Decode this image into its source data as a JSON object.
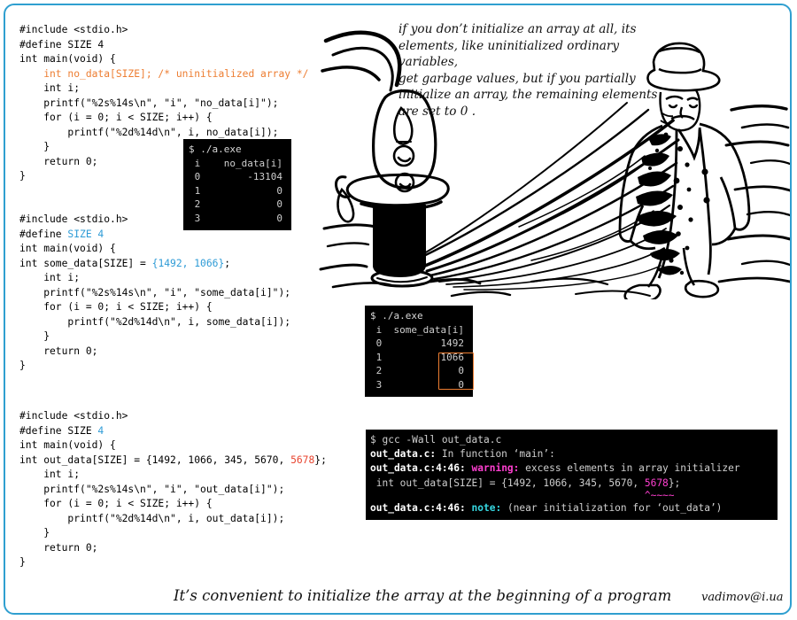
{
  "slide": {
    "border_color": "#2f9fd0",
    "background": "#ffffff"
  },
  "note": {
    "text": "if you don’t initialize an array at all, its\nelements, like uninitialized ordinary variables,\nget garbage values, but if you partially\ninitialize an array, the remaining elements\n        are set to 0 ."
  },
  "illustration": {
    "alt": "ink cartoon: drinking fountain spraying a man in a hat and overcoat"
  },
  "code_blocks": [
    {
      "id": "no_data",
      "lines": [
        [
          {
            "t": "#include <stdio.h>",
            "c": "black"
          }
        ],
        [
          {
            "t": "#define SIZE 4",
            "c": "black"
          }
        ],
        [
          {
            "t": "int main(void) {",
            "c": "black"
          }
        ],
        [
          {
            "t": "    int no_data[SIZE]; /* uninitialized array */",
            "c": "orange"
          }
        ],
        [
          {
            "t": "    int i;",
            "c": "black"
          }
        ],
        [
          {
            "t": "    printf(\"%2s%14s\\n\", \"i\", \"no_data[i]\");",
            "c": "black"
          }
        ],
        [
          {
            "t": "    for (i = 0; i < SIZE; i++) {",
            "c": "black"
          }
        ],
        [
          {
            "t": "        printf(\"%2d%14d\\n\", i, no_data[i]);",
            "c": "black"
          }
        ],
        [
          {
            "t": "    }",
            "c": "black"
          }
        ],
        [
          {
            "t": "    return 0;",
            "c": "black"
          }
        ],
        [
          {
            "t": "}",
            "c": "black"
          }
        ]
      ]
    },
    {
      "id": "some_data",
      "lines": [
        [
          {
            "t": "#include <stdio.h>",
            "c": "black"
          }
        ],
        [
          {
            "t": "#define ",
            "c": "black"
          },
          {
            "t": "SIZE 4",
            "c": "blue"
          }
        ],
        [
          {
            "t": "int main(void) {",
            "c": "black"
          }
        ],
        [
          {
            "t": "int some_data[SIZE] = ",
            "c": "black"
          },
          {
            "t": "{1492, 1066}",
            "c": "blue"
          },
          {
            "t": ";",
            "c": "black"
          }
        ],
        [
          {
            "t": "    int i;",
            "c": "black"
          }
        ],
        [
          {
            "t": "    printf(\"%2s%14s\\n\", \"i\", \"some_data[i]\");",
            "c": "black"
          }
        ],
        [
          {
            "t": "    for (i = 0; i < SIZE; i++) {",
            "c": "black"
          }
        ],
        [
          {
            "t": "        printf(\"%2d%14d\\n\", i, some_data[i]);",
            "c": "black"
          }
        ],
        [
          {
            "t": "    }",
            "c": "black"
          }
        ],
        [
          {
            "t": "    return 0;",
            "c": "black"
          }
        ],
        [
          {
            "t": "}",
            "c": "black"
          }
        ]
      ]
    },
    {
      "id": "out_data",
      "lines": [
        [
          {
            "t": "#include <stdio.h>",
            "c": "black"
          }
        ],
        [
          {
            "t": "#define SIZE ",
            "c": "black"
          },
          {
            "t": "4",
            "c": "blue"
          }
        ],
        [
          {
            "t": "int main(void) {",
            "c": "black"
          }
        ],
        [
          {
            "t": "int out_data[SIZE] = {1492, 1066, 345, 5670, ",
            "c": "black"
          },
          {
            "t": "5678",
            "c": "red"
          },
          {
            "t": "};",
            "c": "black"
          }
        ],
        [
          {
            "t": "    int i;",
            "c": "black"
          }
        ],
        [
          {
            "t": "    printf(\"%2s%14s\\n\", \"i\", \"out_data[i]\");",
            "c": "black"
          }
        ],
        [
          {
            "t": "    for (i = 0; i < SIZE; i++) {",
            "c": "black"
          }
        ],
        [
          {
            "t": "        printf(\"%2d%14d\\n\", i, out_data[i]);",
            "c": "black"
          }
        ],
        [
          {
            "t": "    }",
            "c": "black"
          }
        ],
        [
          {
            "t": "    return 0;",
            "c": "black"
          }
        ],
        [
          {
            "t": "}",
            "c": "black"
          }
        ]
      ]
    }
  ],
  "terminals": {
    "no_data_run": {
      "command": "$ ./a.exe",
      "header": " i    no_data[i]",
      "rows": [
        " 0        -13104",
        " 1             0",
        " 2             0",
        " 3             0"
      ]
    },
    "some_data_run": {
      "command": "$ ./a.exe",
      "header": " i  some_data[i]",
      "rows": [
        " 0          1492",
        " 1          1066",
        " 2             0",
        " 3             0"
      ],
      "highlight_color": "#ED7D31",
      "highlight_note": "last two zeros boxed in orange"
    },
    "compile": {
      "command": "$ gcc -Wall out_data.c",
      "line_infunc_file": "out_data.c:",
      "line_infunc_rest": " In function ‘main’:",
      "warn_loc": "out_data.c:4:46:",
      "warn_label": " warning:",
      "warn_text": " excess elements in array initializer",
      "src_prefix": " int out_data[SIZE] = {1492, 1066, 345, 5670, ",
      "src_excess": "5678",
      "src_suffix": "};",
      "caret": "^~~~~",
      "note_loc": "out_data.c:4:46:",
      "note_label": " note:",
      "note_text": " (near initialization for ‘out_data’)"
    }
  },
  "footer": {
    "caption": "It’s convenient to initialize the array at the beginning of a program",
    "email": "vadimov@i.ua"
  }
}
